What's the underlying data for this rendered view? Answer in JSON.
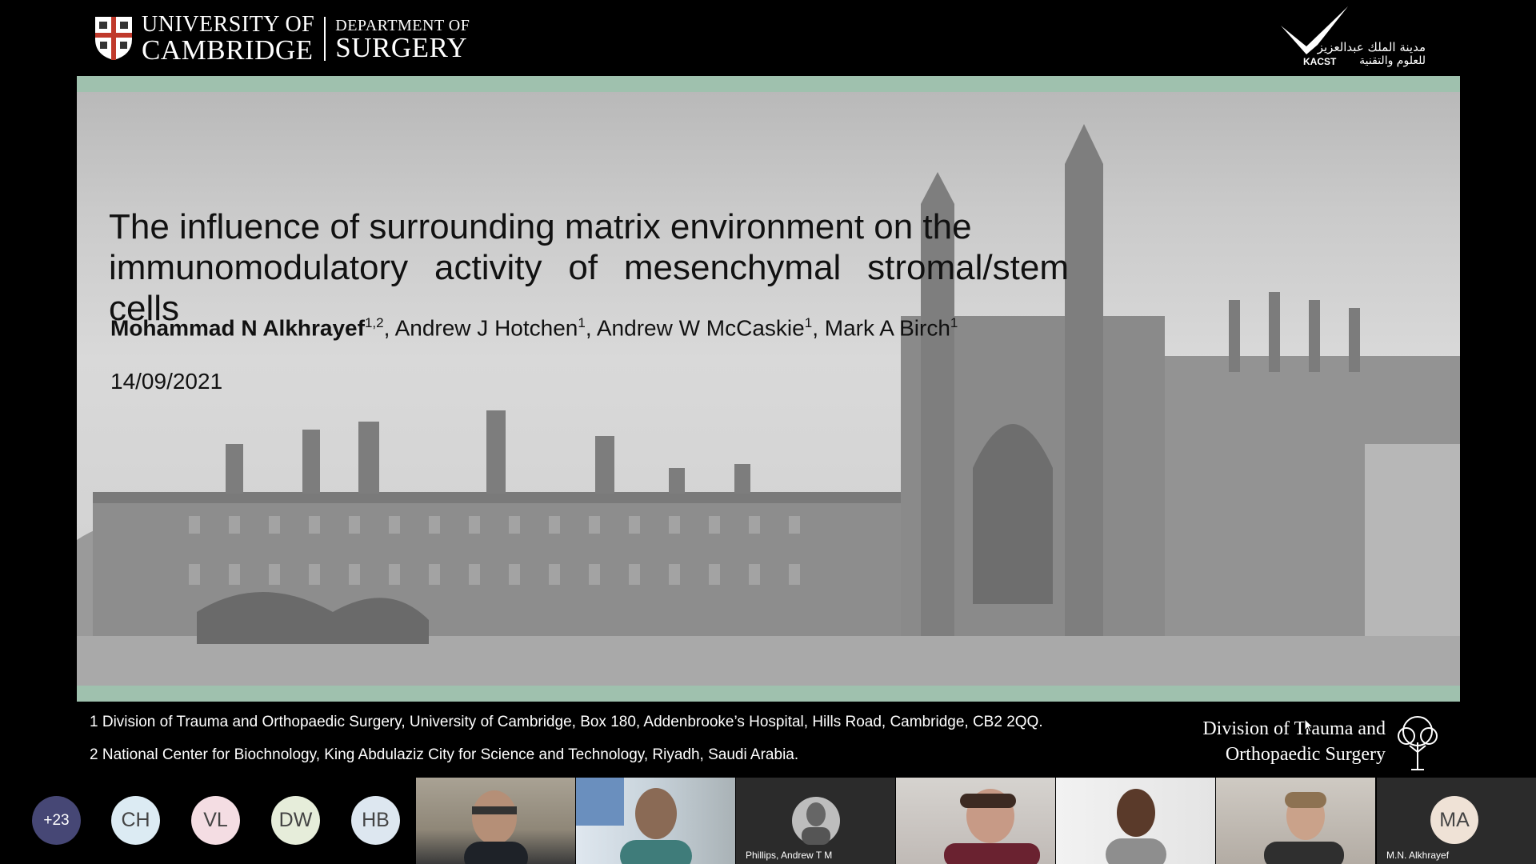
{
  "header": {
    "university_line1": "UNIVERSITY OF",
    "university_line2": "CAMBRIDGE",
    "department_line1": "DEPARTMENT OF",
    "department_line2": "SURGERY",
    "partner_arabic_line1": "مدينة الملك عبدالعزيز",
    "partner_arabic_line2": "للعلوم والتقنية",
    "partner_latin": "KACST"
  },
  "slide": {
    "title_line1": "The influence of surrounding matrix environment on the",
    "title_line2": "immunomodulatory activity of mesenchymal stromal/stem cells",
    "authors": [
      {
        "name": "Mohammad N Alkhrayef",
        "sup": "1,2"
      },
      {
        "name": "Andrew J Hotchen",
        "sup": "1"
      },
      {
        "name": "Andrew W McCaskie",
        "sup": "1"
      },
      {
        "name": "Mark A Birch",
        "sup": "1"
      }
    ],
    "separator": ", ",
    "date": "14/09/2021",
    "affiliation1": "1 Division of Trauma and Orthopaedic Surgery, University of Cambridge, Box 180, Addenbrooke’s Hospital, Hills Road, Cambridge, CB2 2QQ.",
    "affiliation2": "2 National Center for Biochnology, King Abdulaziz City for Science and Technology, Riyadh, Saudi Arabia.",
    "division_line1": "Division of Trauma and",
    "division_line2": "Orthopaedic Surgery"
  },
  "participants": {
    "overflow_count": "+23",
    "initials": [
      {
        "label": "CH",
        "color": "#dcebf3"
      },
      {
        "label": "VL",
        "color": "#f4dde3"
      },
      {
        "label": "DW",
        "color": "#e6edda"
      },
      {
        "label": "HB",
        "color": "#dde7f0"
      }
    ],
    "overflow_color": "#464775",
    "video_tiles": [
      {
        "name": ""
      },
      {
        "name": ""
      },
      {
        "name": "Phillips, Andrew T M"
      },
      {
        "name": ""
      },
      {
        "name": ""
      },
      {
        "name": ""
      }
    ],
    "last_tile": {
      "initials": "MA",
      "name": "M.N. Alkhrayef"
    }
  }
}
